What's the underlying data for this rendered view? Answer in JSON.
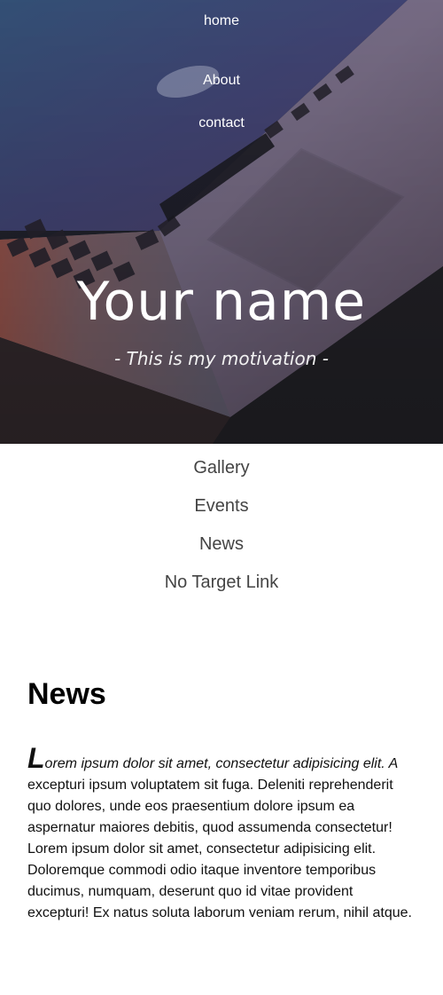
{
  "hero": {
    "nav": [
      {
        "label": "home"
      },
      {
        "label": "About"
      },
      {
        "label": "contact"
      }
    ],
    "title": "Your name",
    "motto": "- This is my motivation -"
  },
  "section_nav": [
    {
      "label": "Gallery"
    },
    {
      "label": "Events"
    },
    {
      "label": "News"
    },
    {
      "label": "No Target Link"
    }
  ],
  "news": {
    "heading": "News",
    "dropcap": "L",
    "lead_in": "orem ipsum dolor sit amet, consectetur adipisicing elit. A",
    "body": " excepturi ipsum voluptatem sit fuga. Deleniti reprehenderit quo dolores, unde eos praesentium dolore ipsum ea aspernatur maiores debitis, quod assumenda consectetur! Lorem ipsum dolor sit amet, consectetur adipisicing elit. Doloremque commodi odio itaque inventore temporibus ducimus, numquam, deserunt quo id vitae provident excepturi! Ex natus soluta laborum veniam rerum, nihil atque."
  }
}
